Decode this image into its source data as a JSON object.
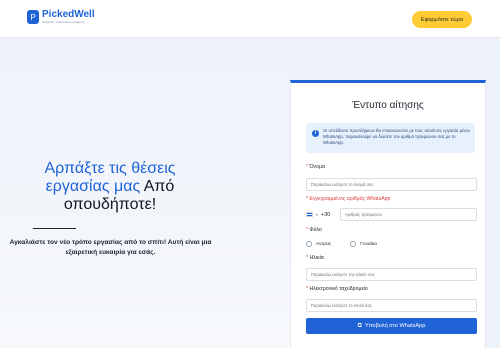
{
  "header": {
    "logo_glyph": "P",
    "logo_name": "PickedWell",
    "logo_tagline": "Network  |  Recruitment Agency",
    "cta_label": "Εφαρμόστε τώρα"
  },
  "hero": {
    "title_part1": "Αρπάξτε τις θέσεις εργασίας μας",
    "title_part2": "Από οπουδήποτε!",
    "subtitle": "Αγκαλιάστε τον νέο τρόπο εργασίας από το σπίτι! Αυτή είναι μια εξαιρετική ευκαιρία για εσάς."
  },
  "form": {
    "title": "Έντυπο αίτησης",
    "info_icon": "i",
    "info_text": "Οι υπεύθυνοι προσλήψεων θα επικοινωνούν με τους αιτούντες εργασία μέσω WhatsApp, παρακαλούμε να δώσετε τον αριθμό τηλεφώνου σας με το WhatsApp.",
    "required_mark": "*",
    "name_label": "Όνομα",
    "name_placeholder": "Παρακαλώ εισάγετε το όνομά σας",
    "whatsapp_label": "Εγγεγραμμένος αριθμός WhatsApp",
    "country_code": "+30",
    "phone_placeholder": "Αριθμός τηλεφώνου",
    "gender_label": "Φύλο",
    "gender_options": [
      "Αντρας",
      "Γυναίκα"
    ],
    "age_label": "Ηλικία",
    "age_placeholder": "Παρακαλώ εισάγετε την ηλικία σας",
    "email_label": "Ηλεκτρονικό ταχυδρομείο",
    "email_placeholder": "Παρακαλώ εισάγετε το email σας",
    "submit_icon": "⧉",
    "submit_label": "Υποβολή στο WhatsApp"
  },
  "colors": {
    "brand_blue": "#1f63d6",
    "cta_yellow": "#ffcc33",
    "required_red": "#d93d3d"
  }
}
